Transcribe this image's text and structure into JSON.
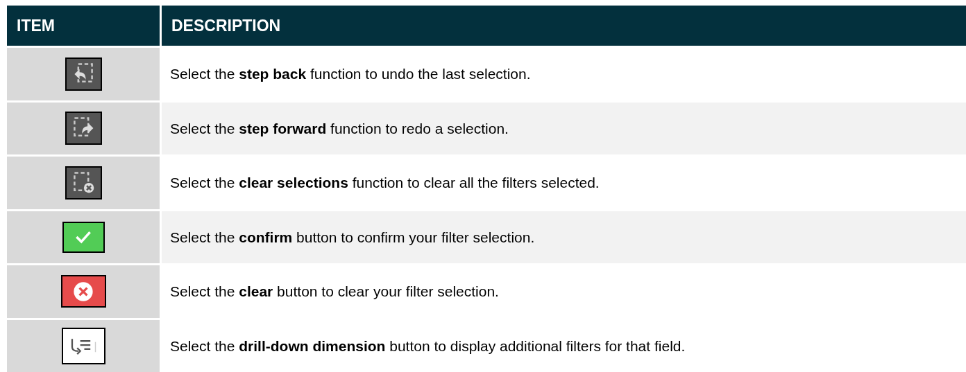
{
  "table": {
    "columns": [
      "ITEM",
      "DESCRIPTION"
    ],
    "rows": [
      {
        "kind": "step_back",
        "shaded": false,
        "description": "Select the **step back** function to undo the last selection."
      },
      {
        "kind": "step_forward",
        "shaded": true,
        "description": "Select the **step forward** function to redo a selection."
      },
      {
        "kind": "clear_selections",
        "shaded": false,
        "description": "Select the **clear selections** function to clear all the filters selected."
      },
      {
        "kind": "confirm",
        "shaded": true,
        "description": "Select the **confirm** button to confirm your filter selection."
      },
      {
        "kind": "clear",
        "shaded": false,
        "description": "Select the **clear** button to clear your filter selection."
      },
      {
        "kind": "drill_down",
        "shaded": false,
        "description": "Select the **drill-down dimension** button to display additional filters for that field."
      }
    ]
  }
}
